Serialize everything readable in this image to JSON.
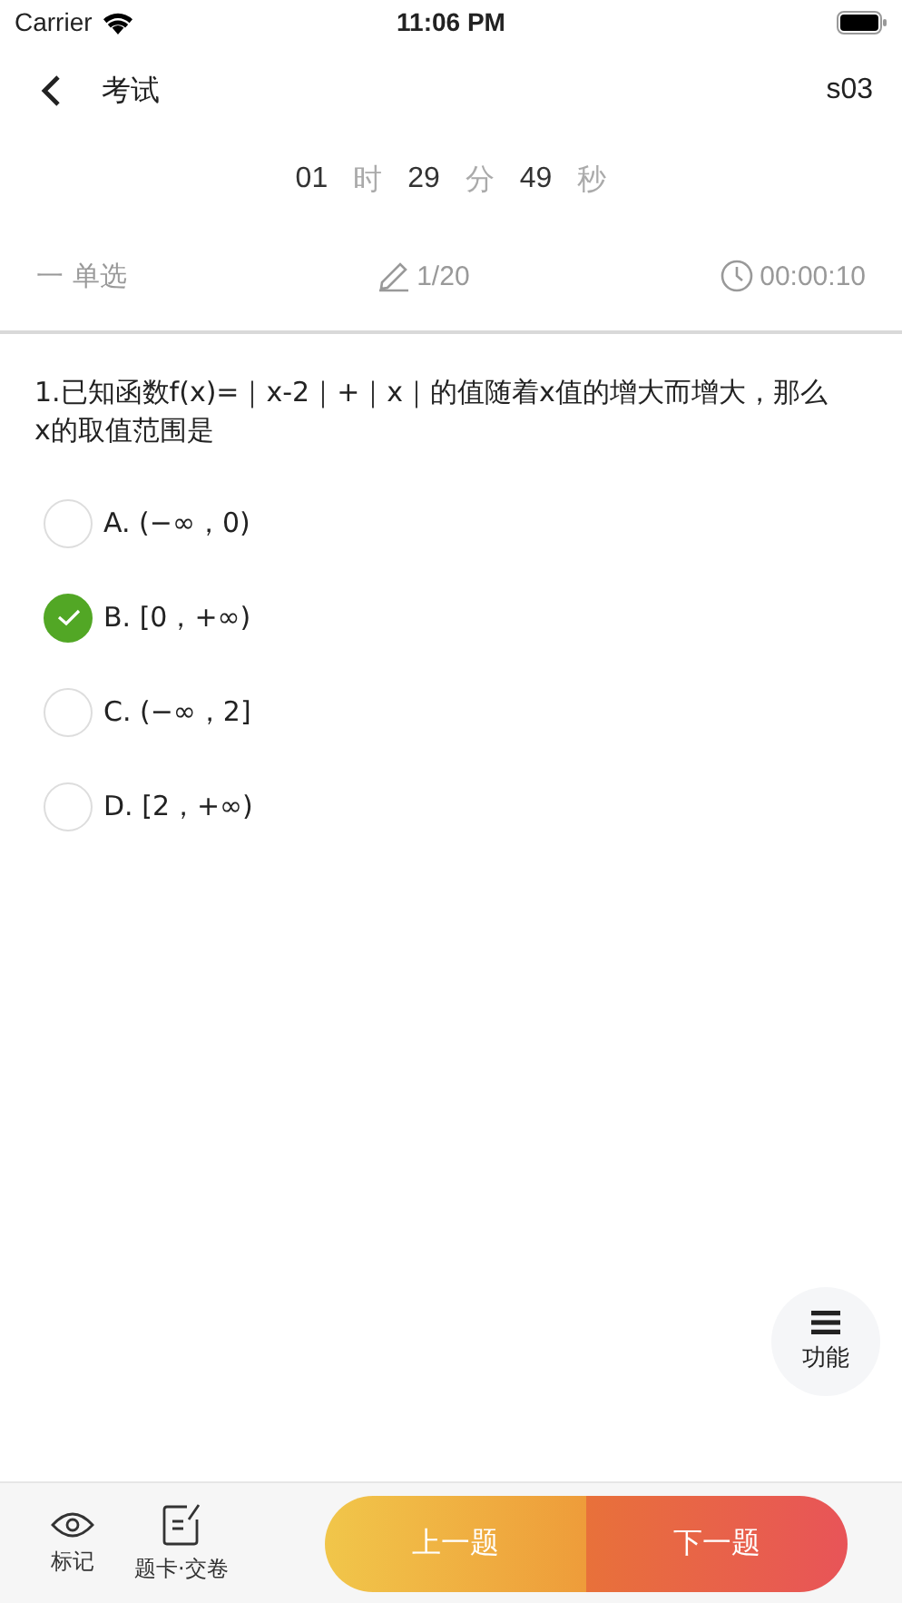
{
  "status_bar": {
    "carrier": "Carrier",
    "time": "11:06 PM"
  },
  "nav": {
    "title": "考试",
    "right": "s03"
  },
  "countdown": [
    {
      "value": "01",
      "unit": "时"
    },
    {
      "value": "29",
      "unit": "分"
    },
    {
      "value": "49",
      "unit": "秒"
    }
  ],
  "info": {
    "type": "一 单选",
    "progress": "1/20",
    "elapsed": "00:00:10"
  },
  "question": "1.已知函数f(x)=｜x-2｜+｜x｜的值随着x值的增大而增大，那么x的取值范围是",
  "options": [
    {
      "label": "A. (−∞，0)",
      "selected": false
    },
    {
      "label": "B. [0，+∞)",
      "selected": true
    },
    {
      "label": "C. (−∞，2]",
      "selected": false
    },
    {
      "label": "D. [2，+∞)",
      "selected": false
    }
  ],
  "fab": "功能",
  "bottom": {
    "mark": "标记",
    "card": "题卡·交卷",
    "prev": "上一题",
    "next": "下一题"
  }
}
